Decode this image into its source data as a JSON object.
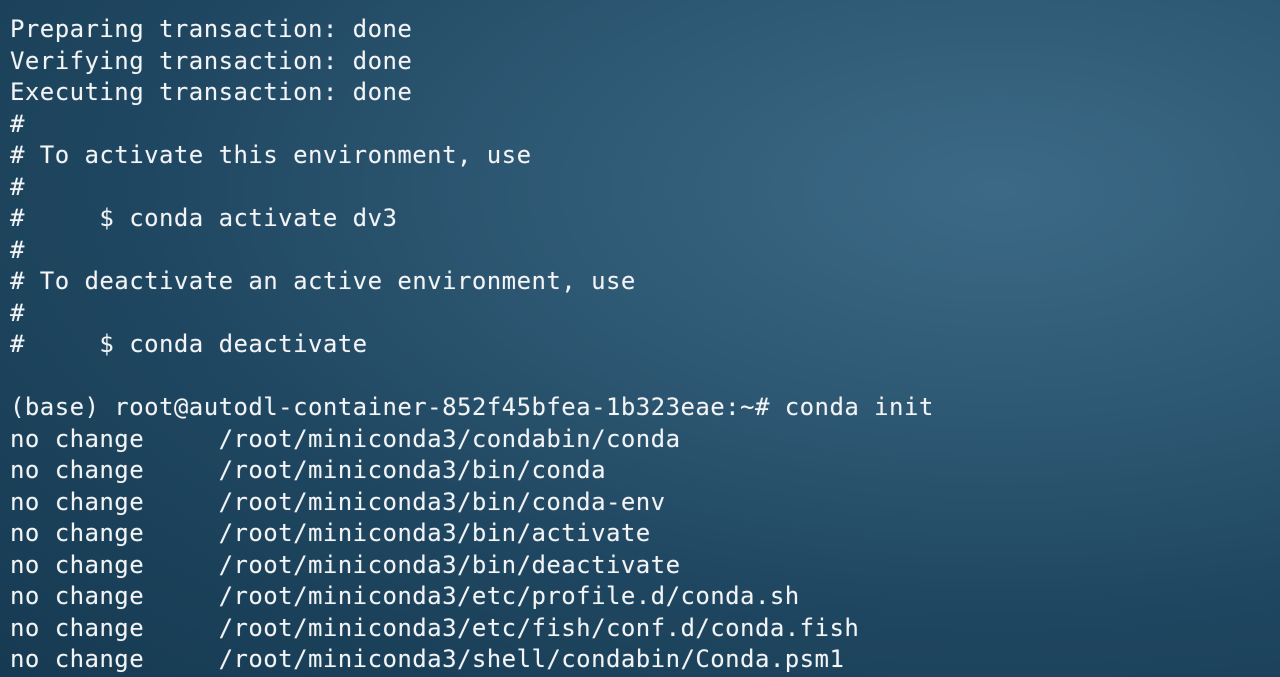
{
  "terminal": {
    "lines": [
      "Preparing transaction: done",
      "Verifying transaction: done",
      "Executing transaction: done",
      "#",
      "# To activate this environment, use",
      "#",
      "#     $ conda activate dv3",
      "#",
      "# To deactivate an active environment, use",
      "#",
      "#     $ conda deactivate",
      "",
      "(base) root@autodl-container-852f45bfea-1b323eae:~# conda init",
      "no change     /root/miniconda3/condabin/conda",
      "no change     /root/miniconda3/bin/conda",
      "no change     /root/miniconda3/bin/conda-env",
      "no change     /root/miniconda3/bin/activate",
      "no change     /root/miniconda3/bin/deactivate",
      "no change     /root/miniconda3/etc/profile.d/conda.sh",
      "no change     /root/miniconda3/etc/fish/conf.d/conda.fish",
      "no change     /root/miniconda3/shell/condabin/Conda.psm1"
    ]
  }
}
